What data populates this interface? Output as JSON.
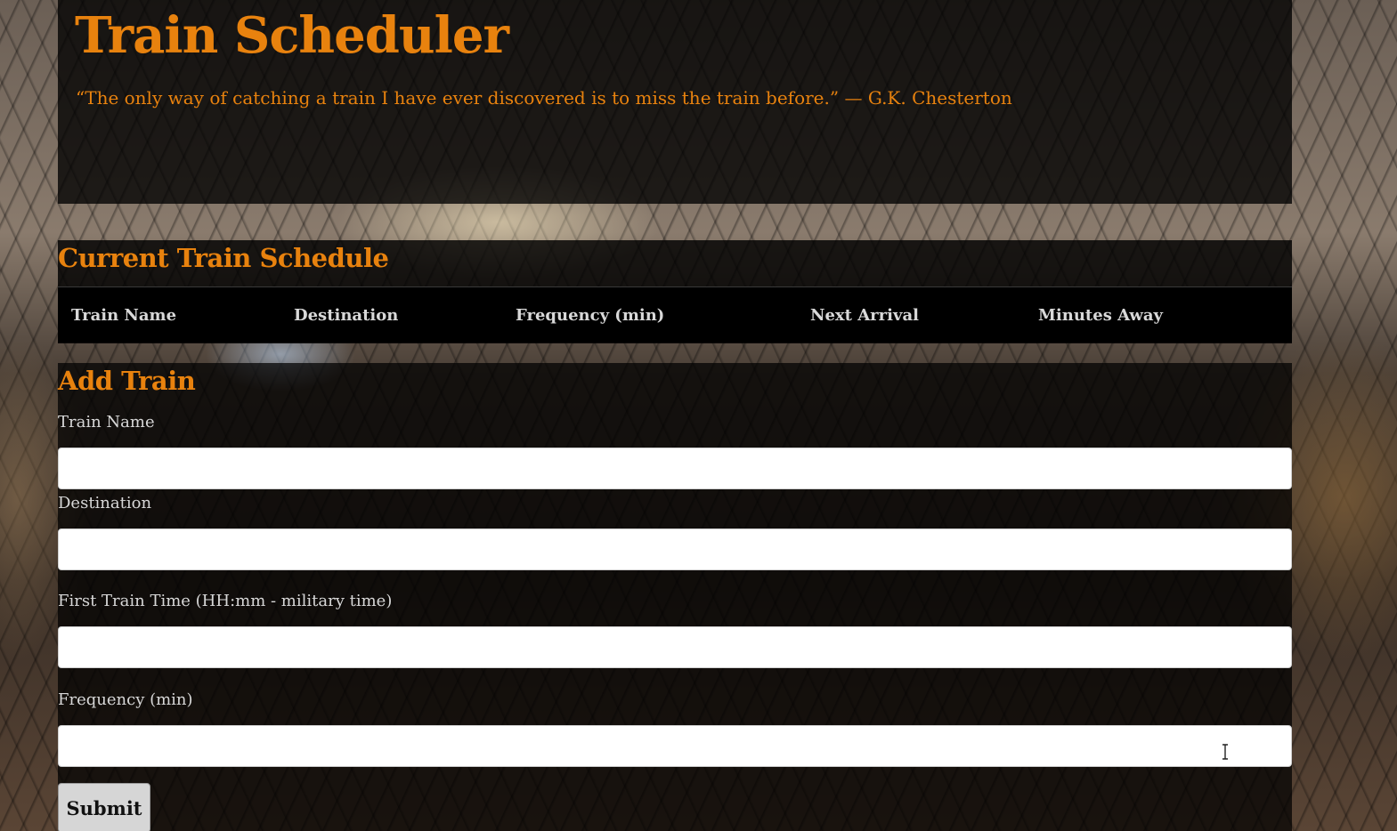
{
  "header": {
    "title": "Train Scheduler",
    "quote": "“The only way of catching a train I have ever discovered is to miss the train before.” — G.K. Chesterton"
  },
  "schedule": {
    "heading": "Current Train Schedule",
    "columns": [
      "Train Name",
      "Destination",
      "Frequency (min)",
      "Next Arrival",
      "Minutes Away"
    ],
    "rows": []
  },
  "add_train": {
    "heading": "Add Train",
    "fields": [
      {
        "label": "Train Name",
        "value": "",
        "placeholder": ""
      },
      {
        "label": "Destination",
        "value": "",
        "placeholder": ""
      },
      {
        "label": "First Train Time (HH:mm - military time)",
        "value": "",
        "placeholder": ""
      },
      {
        "label": "Frequency (min)",
        "value": "",
        "placeholder": ""
      }
    ],
    "submit_label": "Submit"
  },
  "colors": {
    "accent": "#e8820e",
    "panel_bg": "#000000",
    "text_light": "#d8d8d8"
  }
}
